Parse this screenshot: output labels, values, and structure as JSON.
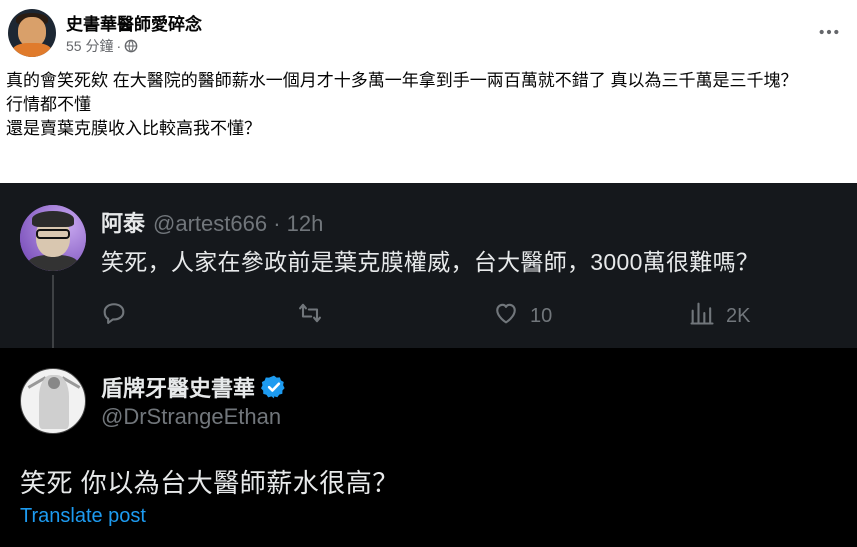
{
  "post": {
    "author": "史書華醫師愛碎念",
    "time": "55 分鐘",
    "separator": "·",
    "privacy_icon": "globe-icon",
    "more_icon": "more-icon",
    "lines": [
      "真的會笑死欸 在大醫院的醫師薪水一個月才十多萬一年拿到手一兩百萬就不錯了 真以為三千萬是三千塊？",
      "行情都不懂",
      "還是賣葉克膜收入比較高我不懂？"
    ]
  },
  "embed": {
    "reply": {
      "name": "阿泰",
      "handle": "@artest666 · 12h",
      "text": "笑死，人家在參政前是葉克膜權威，台大醫師，3000萬很難嗎？",
      "actions": {
        "reply_icon": "reply-icon",
        "retweet_icon": "retweet-icon",
        "like_icon": "heart-icon",
        "likes": "10",
        "views_icon": "views-icon",
        "views": "2K"
      }
    },
    "main": {
      "name": "盾牌牙醫史書華",
      "verified_icon": "verified-icon",
      "handle": "@DrStrangeEthan",
      "text": "笑死 你以為台大醫師薪水很高？",
      "translate": "Translate post"
    }
  },
  "colors": {
    "fb_text": "#050505",
    "fb_meta": "#65676b",
    "dark_bg": "#000000",
    "thread_bg": "#15181c",
    "tweet_text": "#e7e9ea",
    "tweet_muted": "#71767b",
    "link_blue": "#1d9bf0"
  }
}
